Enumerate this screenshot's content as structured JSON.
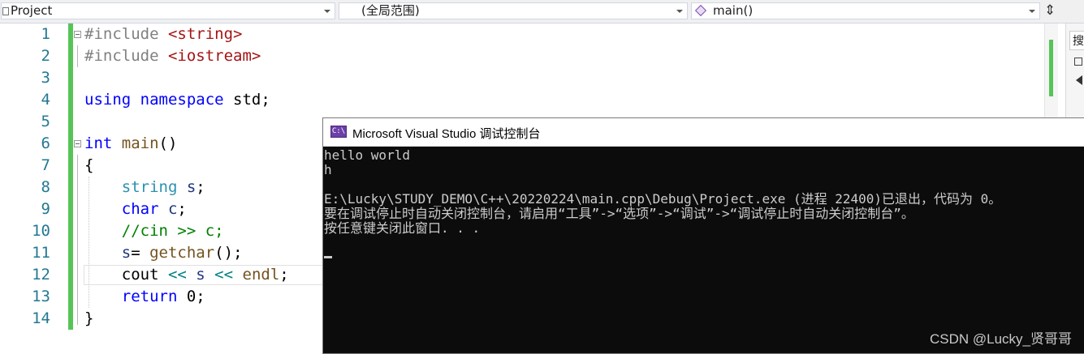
{
  "navbar": {
    "project_combo": "Project",
    "scope_combo": "(全局范围)",
    "member_combo": "main()",
    "split_icon": "split-icon"
  },
  "editor": {
    "lines": [
      {
        "n": "1",
        "parts": [
          [
            "pp",
            "#include "
          ],
          [
            "inc",
            "<string>"
          ]
        ]
      },
      {
        "n": "2",
        "parts": [
          [
            "pp",
            "#include "
          ],
          [
            "inc",
            "<iostream>"
          ]
        ]
      },
      {
        "n": "3",
        "parts": []
      },
      {
        "n": "4",
        "parts": [
          [
            "kw",
            "using "
          ],
          [
            "kw",
            "namespace "
          ],
          [
            "",
            "std;"
          ]
        ]
      },
      {
        "n": "5",
        "parts": []
      },
      {
        "n": "6",
        "parts": [
          [
            "kw",
            "int "
          ],
          [
            "fnc",
            "main"
          ],
          [
            "",
            "()"
          ]
        ]
      },
      {
        "n": "7",
        "parts": [
          [
            "",
            "{"
          ]
        ]
      },
      {
        "n": "8",
        "parts": [
          [
            "",
            "    "
          ],
          [
            "ty",
            "string "
          ],
          [
            "var",
            "s"
          ],
          [
            "",
            ";"
          ]
        ]
      },
      {
        "n": "9",
        "parts": [
          [
            "",
            "    "
          ],
          [
            "kw",
            "char "
          ],
          [
            "var",
            "c"
          ],
          [
            "",
            ";"
          ]
        ]
      },
      {
        "n": "10",
        "parts": [
          [
            "",
            "    "
          ],
          [
            "cm",
            "//cin >> c;"
          ]
        ]
      },
      {
        "n": "11",
        "parts": [
          [
            "",
            "    "
          ],
          [
            "var",
            "s"
          ],
          [
            "",
            "= "
          ],
          [
            "fnc",
            "getchar"
          ],
          [
            "",
            "();"
          ]
        ]
      },
      {
        "n": "12",
        "parts": [
          [
            "",
            "    cout "
          ],
          [
            "op",
            "<< "
          ],
          [
            "var",
            "s "
          ],
          [
            "op",
            "<< "
          ],
          [
            "fnc",
            "endl"
          ],
          [
            "",
            ";"
          ]
        ]
      },
      {
        "n": "13",
        "parts": [
          [
            "",
            "    "
          ],
          [
            "kw",
            "return "
          ],
          [
            "",
            "0;"
          ]
        ]
      },
      {
        "n": "14",
        "parts": [
          [
            "",
            "}"
          ]
        ]
      }
    ]
  },
  "side": {
    "search_label": "搜"
  },
  "console": {
    "title": "Microsoft Visual Studio 调试控制台",
    "icon_text": "C:\\",
    "lines": [
      "hello world",
      "h",
      "",
      "E:\\Lucky\\STUDY_DEMO\\C++\\20220224\\main.cpp\\Debug\\Project.exe (进程 22400)已退出，代码为 0。",
      "要在调试停止时自动关闭控制台，请启用“工具”->“选项”->“调试”->“调试停止时自动关闭控制台”。",
      "按任意键关闭此窗口. . ."
    ]
  },
  "watermark": "CSDN @Lucky_贤哥哥",
  "colors": {
    "keyword": "#0000ff",
    "type": "#2b91af",
    "comment": "#008000",
    "include_path": "#a31515",
    "change_bar": "#57c457",
    "console_bg": "#0c0c0c"
  }
}
